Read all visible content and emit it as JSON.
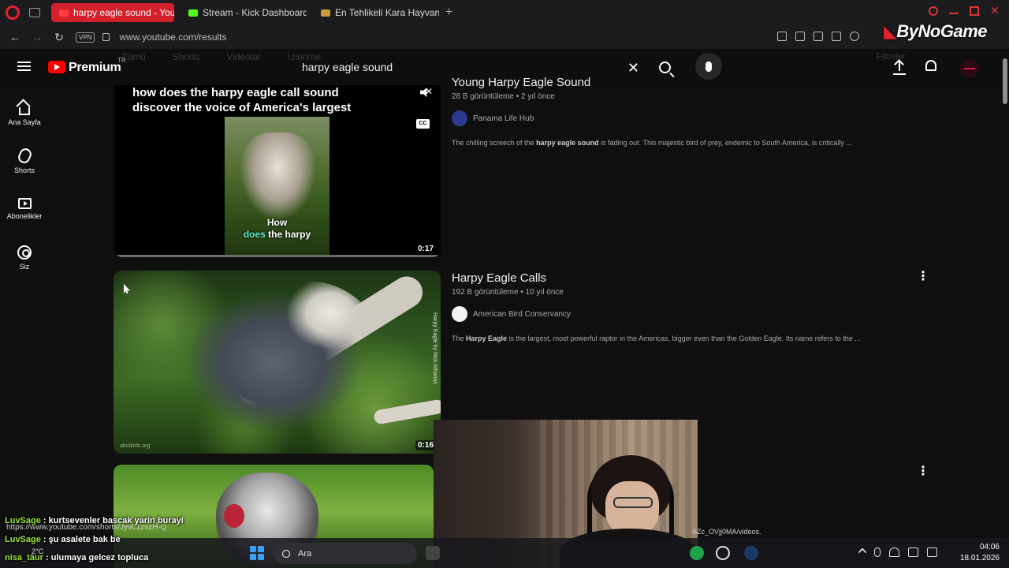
{
  "browser": {
    "tabs": [
      {
        "label": "harpy eagle sound - YouTu",
        "active": true
      },
      {
        "label": "Stream - Kick Dashboard",
        "active": false
      },
      {
        "label": "En Tehlikeli Kara Hayvanı",
        "active": false
      }
    ],
    "new_tab_label": "+",
    "vpn_label": "VPN",
    "url": "www.youtube.com/results",
    "overlay_brand": "ByNoGame"
  },
  "header": {
    "logo_text": "Premium",
    "region": "TR",
    "search_value": "harpy eagle sound",
    "chips_ghost": [
      "Tümü",
      "Shorts",
      "Videolar",
      "İzlenme"
    ],
    "filters_ghost": "Filtreler"
  },
  "sidebar": {
    "items": [
      {
        "label": "Ana Sayfa",
        "icon": "home-icon"
      },
      {
        "label": "Shorts",
        "icon": "shorts-icon"
      },
      {
        "label": "Abonelikler",
        "icon": "subscriptions-icon"
      },
      {
        "label": "Siz",
        "icon": "you-icon"
      }
    ]
  },
  "results": [
    {
      "title": "Young Harpy Eagle Sound",
      "views": "28 B görüntüleme",
      "age": "2 yıl önce",
      "channel": "Panama Life Hub",
      "desc_pre": "The chilling screech of the ",
      "desc_bold": "harpy eagle sound",
      "desc_post": " is fading out. This majestic bird of prey, endemic to South America, is critically ...",
      "thumb_title_line1": "how does the harpy eagle call sound",
      "thumb_title_line2": "discover the voice of America's largest",
      "caption_line1": "How",
      "caption_hl": "does",
      "caption_line2": " the harpy",
      "cc_label": "CC",
      "duration": "0:17"
    },
    {
      "title": "Harpy Eagle Calls",
      "views": "192 B görüntüleme",
      "age": "10 yıl önce",
      "channel": "American Bird Conservancy",
      "desc_pre": "The ",
      "desc_bold": "Harpy Eagle",
      "desc_post": " is the largest, most powerful raptor in the Americas, bigger even than the Golden Eagle. Its name refers to the ...",
      "credit": "abcbirds.org",
      "side_text": "Harpy Eagle by Nick Athanas",
      "duration": "0:16"
    },
    {
      "duration": ""
    }
  ],
  "overlay": {
    "url_text_1": "https://www.youtube.com/shorts/JyvL1zszH-Q",
    "url_text_2": "-6Zc_OVjj0MA/videos.",
    "chat": [
      {
        "user": "LuvSage",
        "sep": " : ",
        "text": "kurtsevenler bascak yarin burayi"
      },
      {
        "user": "LuvSage",
        "sep": " : ",
        "text": "şu asalete bak be"
      },
      {
        "user": "nisa_täur",
        "sep": " : ",
        "text": "ulumaya gelcez topluca"
      }
    ]
  },
  "taskbar": {
    "weather": "2°C",
    "search_placeholder": "Ara",
    "time": "04:06",
    "date": "18.01.2026"
  },
  "colors": {
    "accent": "#ff0000",
    "opera_tab": "#d3202b",
    "chat_user": "#9be43a"
  }
}
